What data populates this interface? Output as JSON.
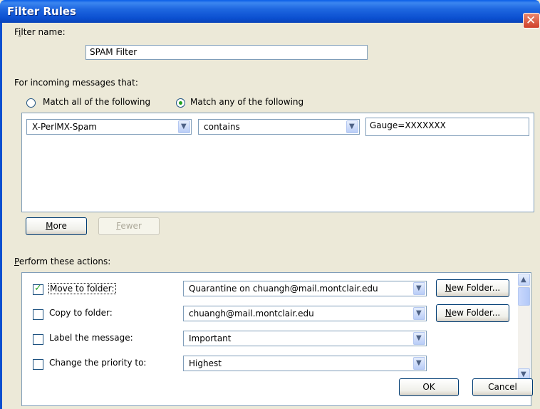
{
  "window": {
    "title": "Filter Rules"
  },
  "filter_name": {
    "label_pre": "F",
    "label_u": "i",
    "label_post": "lter name:",
    "value": "SPAM Filter"
  },
  "incoming": {
    "heading": "For incoming messages that:",
    "match_all": "Match all of the following",
    "match_any": "Match any of the following",
    "selected": "match_any"
  },
  "condition": {
    "header": "X-PerlMX-Spam",
    "operator": "contains",
    "value": "Gauge=XXXXXXX"
  },
  "buttons": {
    "more_u": "M",
    "more_rest": "ore",
    "fewer_u": "F",
    "fewer_rest": "ewer",
    "ok": "OK",
    "cancel": "Cancel"
  },
  "actions": {
    "heading_u": "P",
    "heading_rest": "erform these actions:",
    "new_folder_u": "N",
    "new_folder_rest": "ew Folder...",
    "items": [
      {
        "label": "Move to folder:",
        "checked": true,
        "value": "Quarantine on chuangh@mail.montclair.edu"
      },
      {
        "label": "Copy to folder:",
        "checked": false,
        "value": "chuangh@mail.montclair.edu"
      },
      {
        "label": "Label the message:",
        "checked": false,
        "value": "Important"
      },
      {
        "label": "Change the priority to:",
        "checked": false,
        "value": "Highest"
      }
    ]
  },
  "icons": {
    "close": "close-icon",
    "dropdown": "chevron-down-icon",
    "check": "checkmark-icon",
    "scroll_up": "arrow-up-icon",
    "scroll_down": "arrow-down-icon"
  },
  "colors": {
    "titlebar": "#0B4FD0",
    "face": "#ECE9D8",
    "accent_check": "#21A121"
  }
}
